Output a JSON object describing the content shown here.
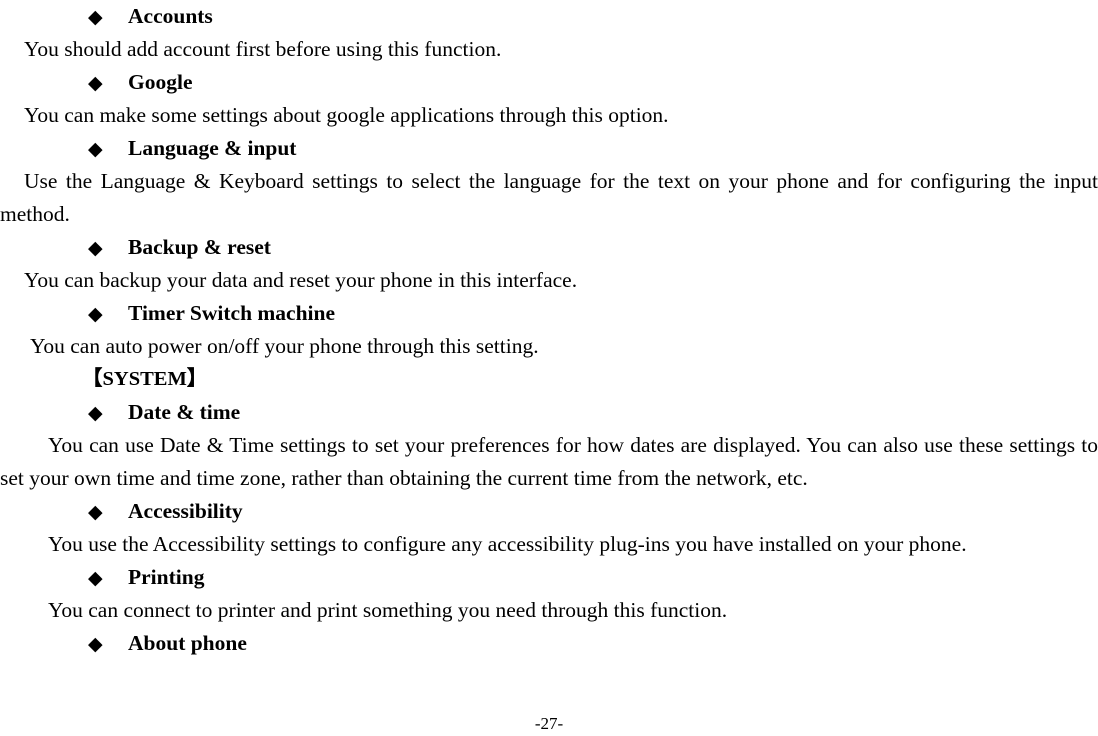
{
  "document": {
    "page_number": "-27-",
    "bullet_glyph": "◆",
    "blocks": [
      {
        "type": "heading",
        "text": "Accounts"
      },
      {
        "type": "paragraph",
        "text": "You should add account first before using this function."
      },
      {
        "type": "heading",
        "text": "Google"
      },
      {
        "type": "paragraph",
        "text": "You can make some settings about google applications through this option."
      },
      {
        "type": "heading",
        "text": "Language & input"
      },
      {
        "type": "paragraph",
        "text": "Use the Language & Keyboard settings to select the language for the text on your phone and for configuring the input method."
      },
      {
        "type": "heading",
        "text": "Backup & reset"
      },
      {
        "type": "paragraph",
        "text": "You can backup your data and reset your phone in this interface."
      },
      {
        "type": "heading",
        "text": "Timer Switch machine"
      },
      {
        "type": "paragraph",
        "text": "You can auto power on/off your phone through this setting."
      },
      {
        "type": "section",
        "text": "【SYSTEM】"
      },
      {
        "type": "heading",
        "text": "Date & time"
      },
      {
        "type": "paragraph",
        "text": "You can use Date & Time settings to set your preferences for how dates are displayed. You can also use these settings to set your own time and time zone, rather than obtaining the current time from the network, etc."
      },
      {
        "type": "heading",
        "text": "Accessibility"
      },
      {
        "type": "paragraph",
        "text": "You use the Accessibility settings to configure any accessibility plug-ins you have installed on your phone."
      },
      {
        "type": "heading",
        "text": "Printing"
      },
      {
        "type": "paragraph",
        "text": "You can connect to printer and print something you need through this function."
      },
      {
        "type": "heading",
        "text": "About phone"
      }
    ]
  }
}
